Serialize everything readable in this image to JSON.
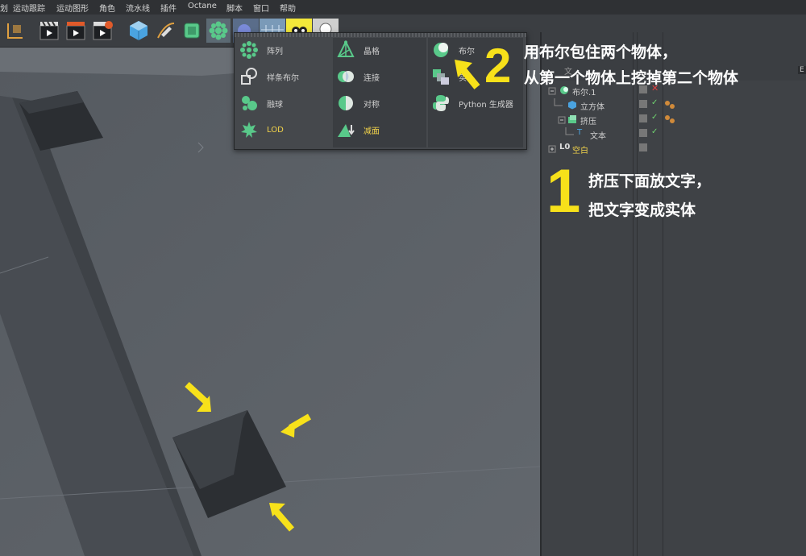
{
  "menu": {
    "items": [
      "划",
      "运动跟踪",
      "运动图形",
      "角色",
      "流水线",
      "插件",
      "Octane",
      "脚本",
      "窗口",
      "帮助"
    ]
  },
  "popup": {
    "col1": [
      {
        "label": "阵列",
        "icon": "array-icon"
      },
      {
        "label": "样条布尔",
        "icon": "spline-boolean-icon"
      },
      {
        "label": "融球",
        "icon": "metaball-icon"
      },
      {
        "label": "LOD",
        "icon": "lod-icon"
      }
    ],
    "col2": [
      {
        "label": "晶格",
        "icon": "atom-array-icon"
      },
      {
        "label": "连接",
        "icon": "connect-icon"
      },
      {
        "label": "对称",
        "icon": "symmetry-icon"
      },
      {
        "label": "减面",
        "icon": "polygon-reduction-icon"
      }
    ],
    "col3": [
      {
        "label": "布尔",
        "icon": "boolean-icon"
      },
      {
        "label": "实",
        "icon": "instance-icon"
      },
      {
        "label": "Python 生成器",
        "icon": "python-generator-icon"
      }
    ]
  },
  "objects": {
    "rows": [
      {
        "label": "布尔.1",
        "icon": "boolean-icon"
      },
      {
        "label": "立方体",
        "icon": "cube-icon"
      },
      {
        "label": "挤压",
        "icon": "extrude-icon"
      },
      {
        "label": "文本",
        "icon": "text-icon"
      },
      {
        "label": "空白",
        "icon": "null-icon"
      }
    ],
    "header_partial": "文",
    "corner_label": "E"
  },
  "annotations": {
    "step2_number": "2",
    "step2_line1": "用布尔包住两个物体，",
    "step2_line2": "从第一个物体上挖掉第二个物体",
    "step1_number": "1",
    "step1_line1": "挤压下面放文字，",
    "step1_line2": "把文字变成实体"
  },
  "colors": {
    "annotation_yellow": "#f7e11a",
    "active_yellow": "#f2d34a",
    "check_green": "#6fd36f",
    "icon_green": "#59c98a",
    "cube_blue": "#4aa3e0"
  }
}
